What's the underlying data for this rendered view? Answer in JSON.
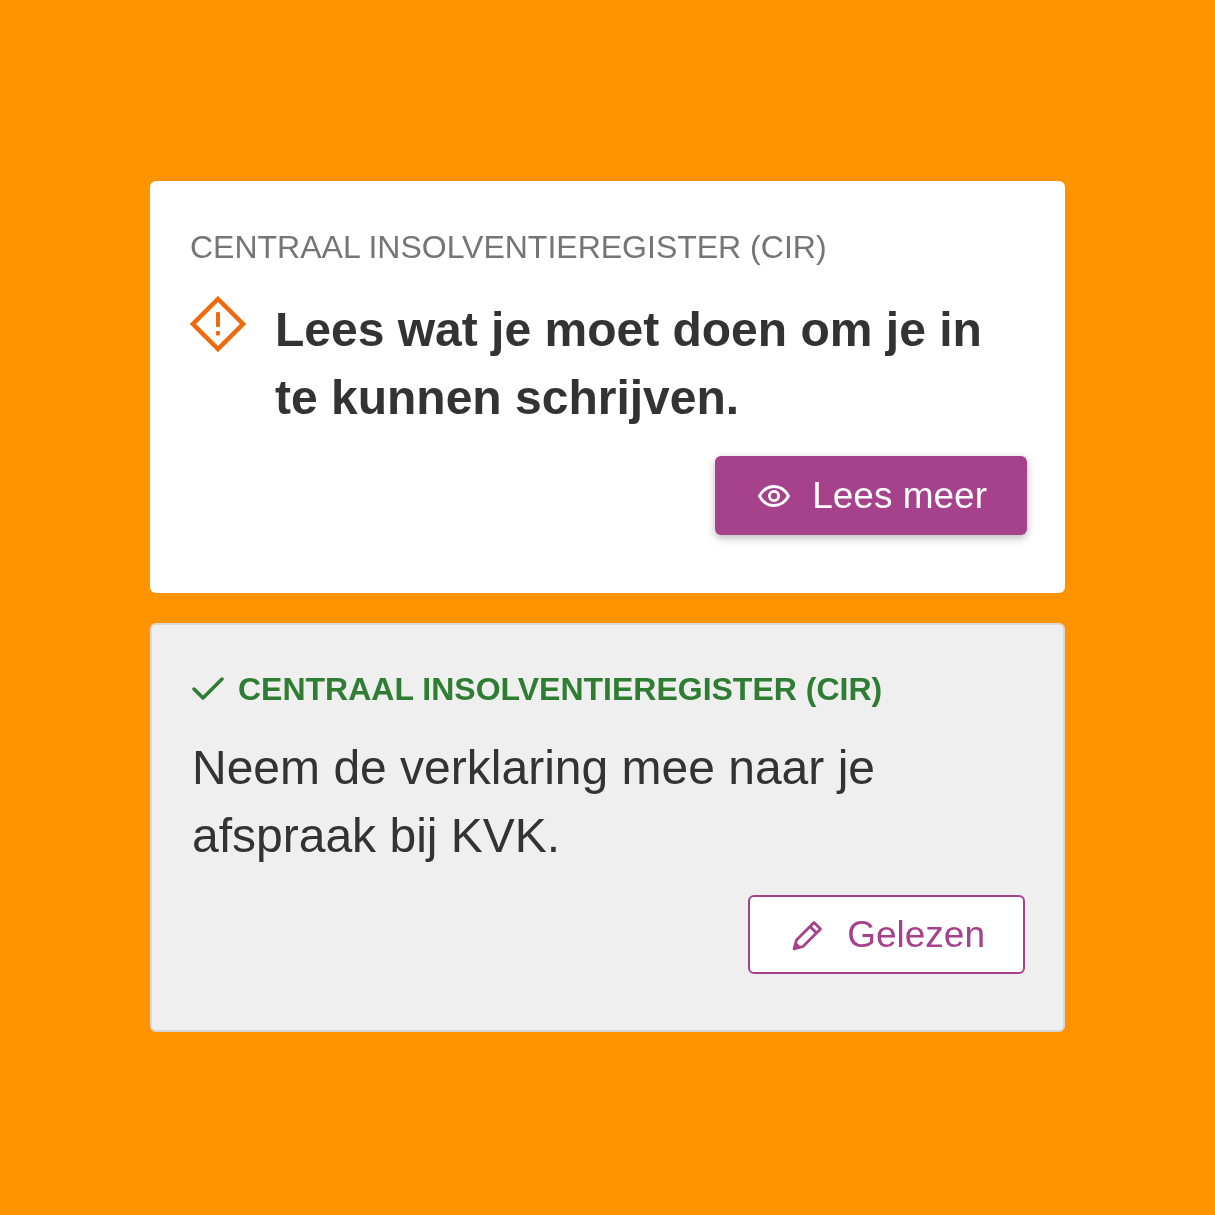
{
  "cards": [
    {
      "heading": "CENTRAAL INSOLVENTIEREGISTER (CIR)",
      "done": false,
      "message": "Lees wat je moet doen om je in te kunnen schrijven.",
      "button": {
        "label": "Lees meer"
      }
    },
    {
      "heading": "CENTRAAL INSOLVENTIEREGISTER (CIR)",
      "done": true,
      "message": "Neem de verklaring mee naar je afspraak bij KVK.",
      "button": {
        "label": "Gelezen"
      }
    }
  ]
}
